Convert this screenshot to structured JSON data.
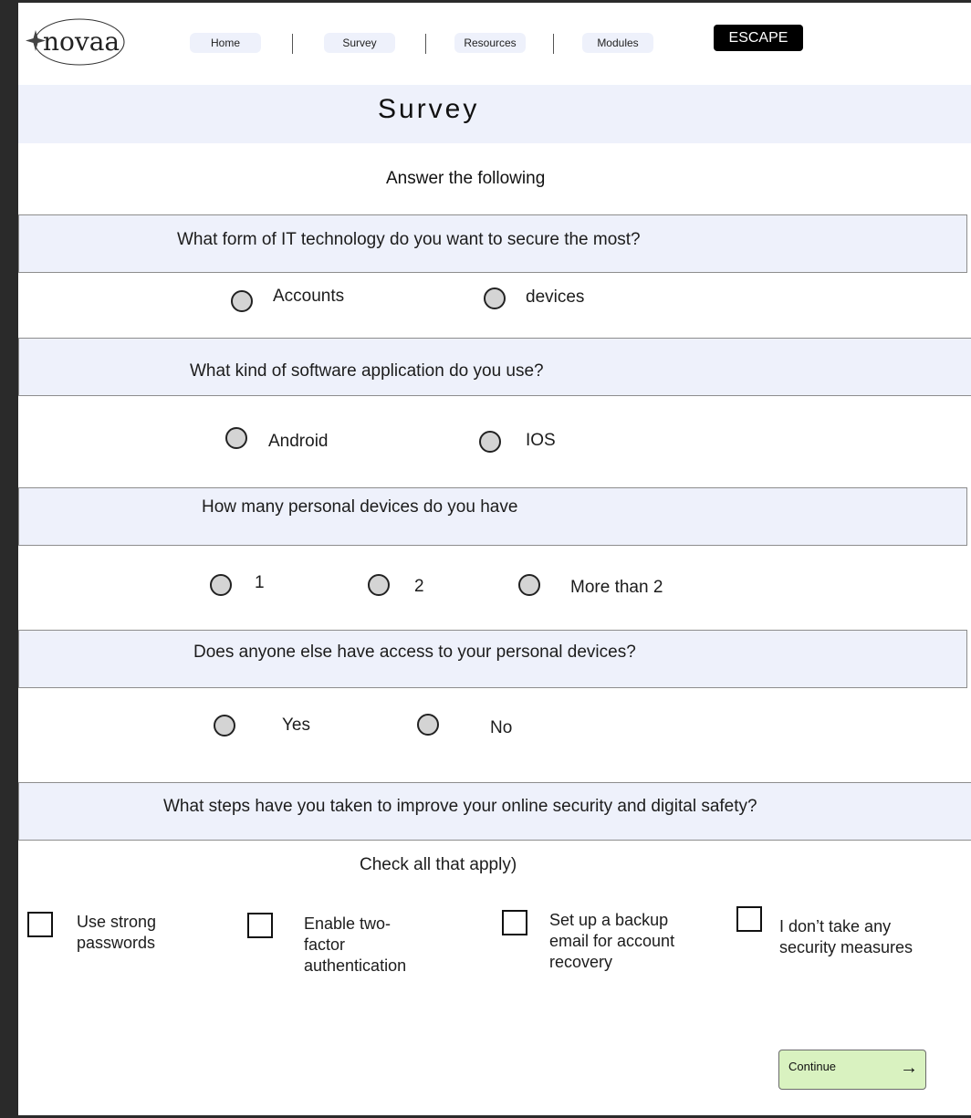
{
  "brand": {
    "logo_text": "novaa"
  },
  "nav": {
    "items": [
      {
        "label": "Home"
      },
      {
        "label": "Survey"
      },
      {
        "label": "Resources"
      },
      {
        "label": "Modules"
      }
    ],
    "escape_label": "ESCAPE"
  },
  "page": {
    "title": "Survey",
    "intro": "Answer the following"
  },
  "questions": [
    {
      "text": "What form of IT technology do you want to secure the most?",
      "options": [
        "Accounts",
        "devices"
      ]
    },
    {
      "text": "What kind of software application do you use?",
      "options": [
        "Android",
        "IOS"
      ]
    },
    {
      "text": "How many personal devices do you have",
      "options": [
        "1",
        "2",
        "More than 2"
      ]
    },
    {
      "text": "Does anyone else have access to your personal devices?",
      "options": [
        "Yes",
        "No"
      ]
    },
    {
      "text": "What steps have you taken to improve your online security and digital safety?",
      "subtext": "Check all that apply)",
      "checkboxes": [
        "Use strong passwords",
        "Enable two-factor authentication",
        "Set up a backup email for account recovery",
        "I don’t take any security measures"
      ]
    }
  ],
  "continue": {
    "label": "Continue",
    "arrow": "→"
  },
  "colors": {
    "band": "#eef1fb",
    "escape_bg": "#000000",
    "continue_bg": "#d9f2c0",
    "radio_fill": "#d4d4d4"
  }
}
